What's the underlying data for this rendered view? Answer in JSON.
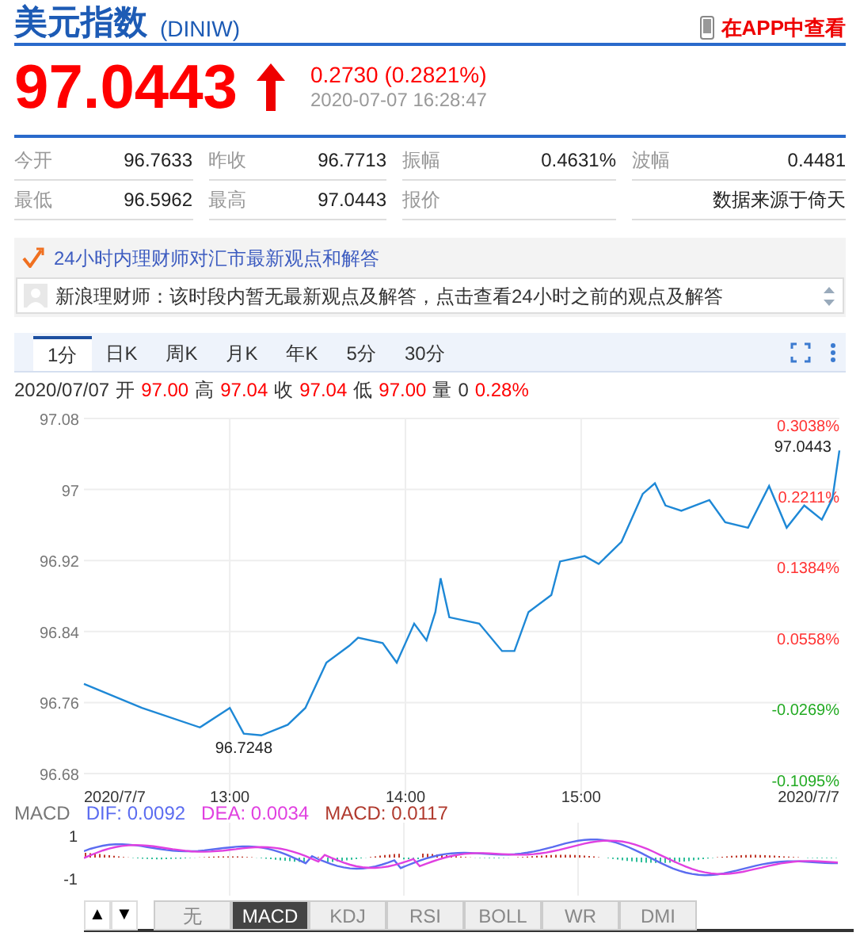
{
  "header": {
    "title": "美元指数",
    "code": "(DINIW)",
    "app_link": "在APP中查看"
  },
  "quote": {
    "price": "97.0443",
    "change": "0.2730 (0.2821%)",
    "time": "2020-07-07 16:28:47"
  },
  "stats": [
    [
      {
        "label": "今开",
        "value": "96.7633"
      },
      {
        "label": "昨收",
        "value": "96.7713"
      },
      {
        "label": "振幅",
        "value": "0.4631%"
      },
      {
        "label": "波幅",
        "value": "0.4481"
      }
    ],
    [
      {
        "label": "最低",
        "value": "96.5962"
      },
      {
        "label": "最高",
        "value": "97.0443"
      },
      {
        "label": "报价"
      },
      {
        "value": "数据来源于倚天"
      }
    ]
  ],
  "views": {
    "heading": "24小时内理财师对汇市最新观点和解答",
    "message": "新浪理财师：该时段内暂无最新观点及解答，点击查看24小时之前的观点及解答"
  },
  "period_tabs": [
    {
      "label": "1分",
      "selected": true
    },
    {
      "label": "日K",
      "selected": false
    },
    {
      "label": "周K",
      "selected": false
    },
    {
      "label": "月K",
      "selected": false
    },
    {
      "label": "年K",
      "selected": false
    },
    {
      "label": "5分",
      "selected": false
    },
    {
      "label": "30分",
      "selected": false
    }
  ],
  "bar_info": {
    "date": "2020/07/07",
    "items": [
      {
        "label": "开",
        "value": "97.00",
        "color": "#ff0000"
      },
      {
        "label": "高",
        "value": "97.04",
        "color": "#ff0000"
      },
      {
        "label": "收",
        "value": "97.04",
        "color": "#ff0000"
      },
      {
        "label": "低",
        "value": "97.00",
        "color": "#ff0000"
      },
      {
        "label": "量",
        "value": "0",
        "color": "#333333"
      }
    ],
    "change": "0.28%"
  },
  "price_chart": {
    "chart_data": {
      "type": "line",
      "x": [
        12.17,
        12.5,
        12.83,
        13,
        13.08,
        13.18,
        13.33,
        13.43,
        13.55,
        13.68,
        13.73,
        13.87,
        13.95,
        14.05,
        14.12,
        14.17,
        14.2,
        14.25,
        14.42,
        14.55,
        14.62,
        14.7,
        14.83,
        14.88,
        15.02,
        15.1,
        15.23,
        15.35,
        15.42,
        15.48,
        15.57,
        15.73,
        15.82,
        15.95,
        16.07,
        16.17,
        16.27,
        16.37,
        16.43,
        16.47
      ],
      "series": [
        {
          "color": "#1e88d6",
          "values": [
            96.781,
            96.754,
            96.732,
            96.754,
            96.725,
            96.723,
            96.735,
            96.754,
            96.805,
            96.824,
            96.833,
            96.827,
            96.805,
            96.849,
            96.83,
            96.862,
            96.9,
            96.856,
            96.849,
            96.818,
            96.818,
            96.862,
            96.881,
            96.919,
            96.925,
            96.916,
            96.941,
            96.995,
            97.007,
            96.982,
            96.976,
            96.988,
            96.963,
            96.957,
            97.004,
            96.957,
            96.982,
            96.966,
            96.99,
            97.044
          ]
        }
      ],
      "grid": true,
      "xlim": [
        12.17,
        16.47
      ],
      "ylim": [
        96.68,
        97.08
      ],
      "xticks": [
        {
          "value": 12.17,
          "label": "2020/7/7"
        },
        {
          "value": 13,
          "label": "13:00"
        },
        {
          "value": 14,
          "label": "14:00"
        },
        {
          "value": 15,
          "label": "15:00"
        },
        {
          "value": 16.47,
          "label": "2020/7/7"
        }
      ],
      "yticks": [
        {
          "value": 97.08,
          "label": "97.08"
        },
        {
          "value": 97,
          "label": "97"
        },
        {
          "value": 96.92,
          "label": "96.92"
        },
        {
          "value": 96.84,
          "label": "96.84"
        },
        {
          "value": 96.76,
          "label": "96.76"
        },
        {
          "value": 96.68,
          "label": "96.68"
        }
      ],
      "annotations": [
        {
          "x": 13.08,
          "y": 96.7248,
          "text": "96.7248"
        },
        {
          "x": 16.47,
          "y": 97.0443,
          "text": "97.0443"
        }
      ]
    },
    "percent_ticks": [
      {
        "label": "0.3038%",
        "color": "#ff3333"
      },
      {
        "label": "0.2211%",
        "color": "#ff3333"
      },
      {
        "label": "0.1384%",
        "color": "#ff3333"
      },
      {
        "label": "0.0558%",
        "color": "#ff3333"
      },
      {
        "label": "-0.0269%",
        "color": "#22aa22"
      },
      {
        "label": "-0.1095%",
        "color": "#22aa22"
      }
    ]
  },
  "macd": {
    "name": "MACD",
    "legend": [
      {
        "text": "DIF: 0.0092",
        "color": "#5b6cf0"
      },
      {
        "text": "DEA: 0.0034",
        "color": "#e040e0"
      },
      {
        "text": "MACD: 0.0117",
        "color": "#b03a2e"
      }
    ],
    "axis": [
      "1",
      "-1"
    ]
  },
  "indicator_tabs": [
    {
      "label": "无",
      "selected": false
    },
    {
      "label": "MACD",
      "selected": true
    },
    {
      "label": "KDJ",
      "selected": false
    },
    {
      "label": "RSI",
      "selected": false
    },
    {
      "label": "BOLL",
      "selected": false
    },
    {
      "label": "WR",
      "selected": false
    },
    {
      "label": "DMI",
      "selected": false
    }
  ],
  "step_buttons": [
    "▲",
    "▼"
  ]
}
